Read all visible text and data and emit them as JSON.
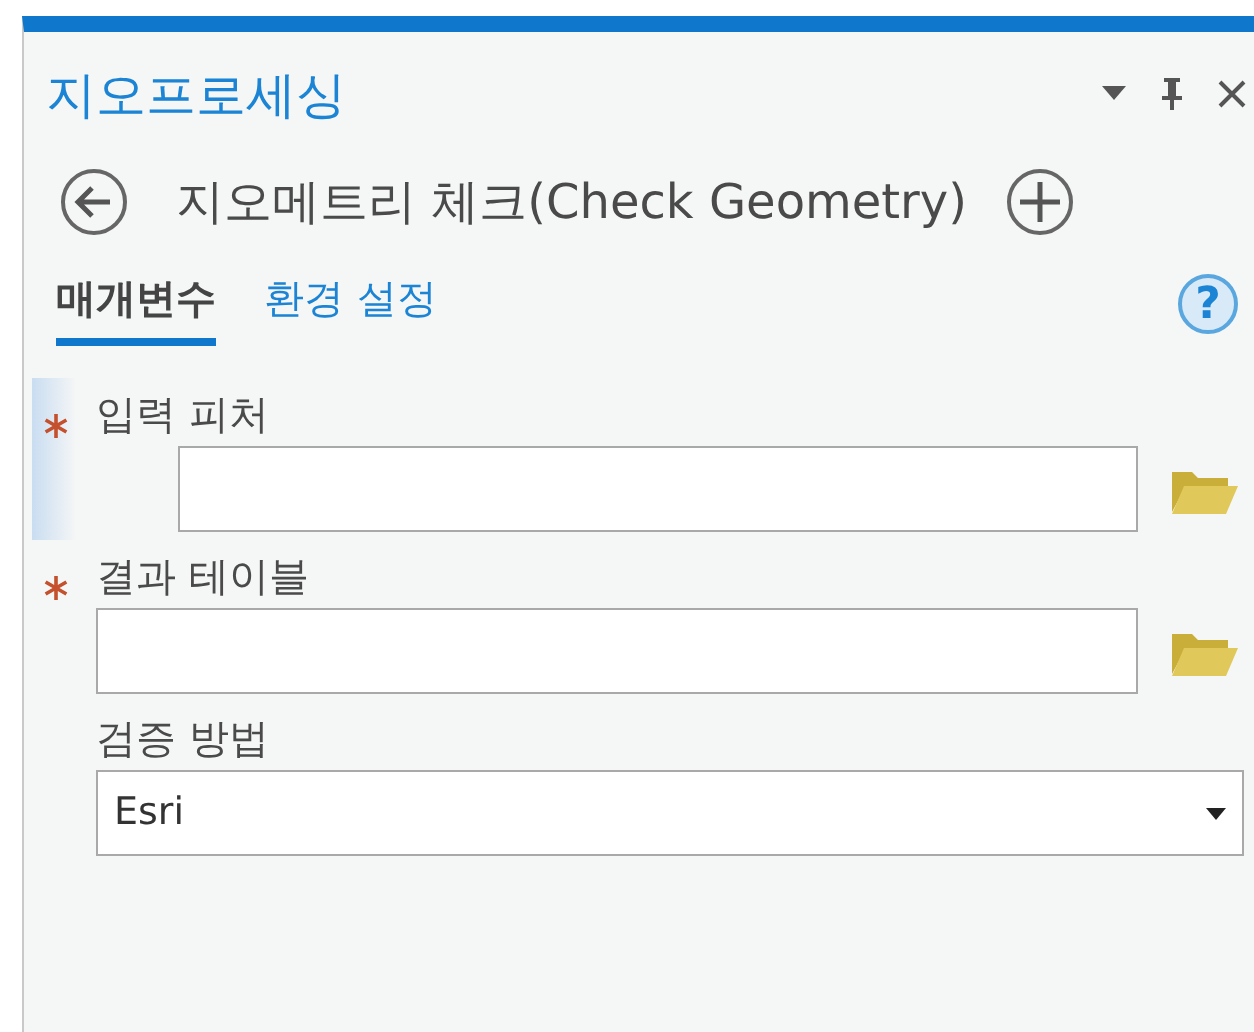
{
  "pane": {
    "title": "지오프로세싱"
  },
  "tool": {
    "title": "지오메트리 체크(Check Geometry)"
  },
  "tabs": [
    {
      "label": "매개변수",
      "selected": true
    },
    {
      "label": "환경 설정",
      "selected": false
    }
  ],
  "help": {
    "label": "?"
  },
  "parameters": [
    {
      "label": "입력 피처",
      "required": true,
      "active": true,
      "kind": "dataset"
    },
    {
      "label": "결과 테이블",
      "required": true,
      "active": false,
      "kind": "dataset"
    },
    {
      "label": "검증 방법",
      "required": false,
      "active": false,
      "kind": "dropdown",
      "value": "Esri"
    }
  ]
}
